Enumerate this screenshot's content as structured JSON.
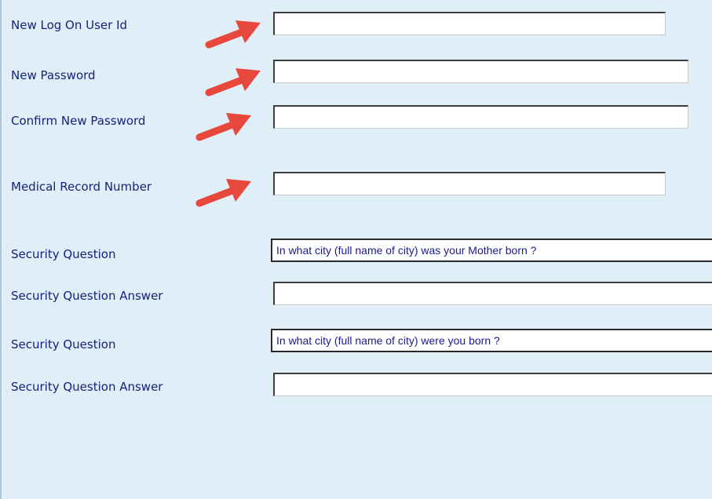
{
  "form": {
    "user_id": {
      "label": "New Log On User Id",
      "value": ""
    },
    "password": {
      "label": "New Password",
      "value": ""
    },
    "confirm_password": {
      "label": "Confirm New Password",
      "value": ""
    },
    "mrn": {
      "label": "Medical Record Number",
      "value": ""
    },
    "security_question_1": {
      "label": "Security Question",
      "selected": "In what city (full name of city) was your Mother born ?"
    },
    "security_answer_1": {
      "label": "Security Question Answer",
      "value": ""
    },
    "security_question_2": {
      "label": "Security Question",
      "selected": "In what city (full name of city) were you born ?"
    },
    "security_answer_2": {
      "label": "Security Question Answer",
      "value": ""
    }
  },
  "annotations": {
    "arrow_color": "#e8473c",
    "arrow_count": 4
  },
  "colors": {
    "background": "#e0eef7",
    "label_text": "#14237a",
    "select_text": "#1b1b8c"
  }
}
